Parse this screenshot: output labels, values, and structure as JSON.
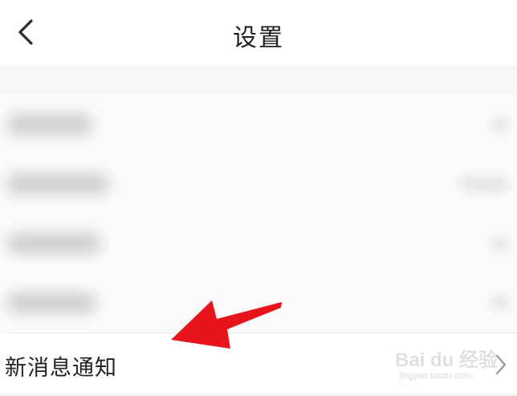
{
  "header": {
    "title": "设置",
    "back_icon": "chevron-left-icon"
  },
  "settings": {
    "blurred_items_count_visible": 4,
    "notification_item": {
      "label": "新消息通知",
      "icon": "chevron-right-icon"
    }
  },
  "annotation": {
    "arrow_color": "#e8141c"
  },
  "watermark": {
    "brand": "Bai du 经验",
    "url": "jingyan.baidu.com"
  },
  "colors": {
    "background": "#ffffff",
    "spacer": "#f7f7f7",
    "text": "#222222",
    "chevron": "#9b9b9b"
  }
}
